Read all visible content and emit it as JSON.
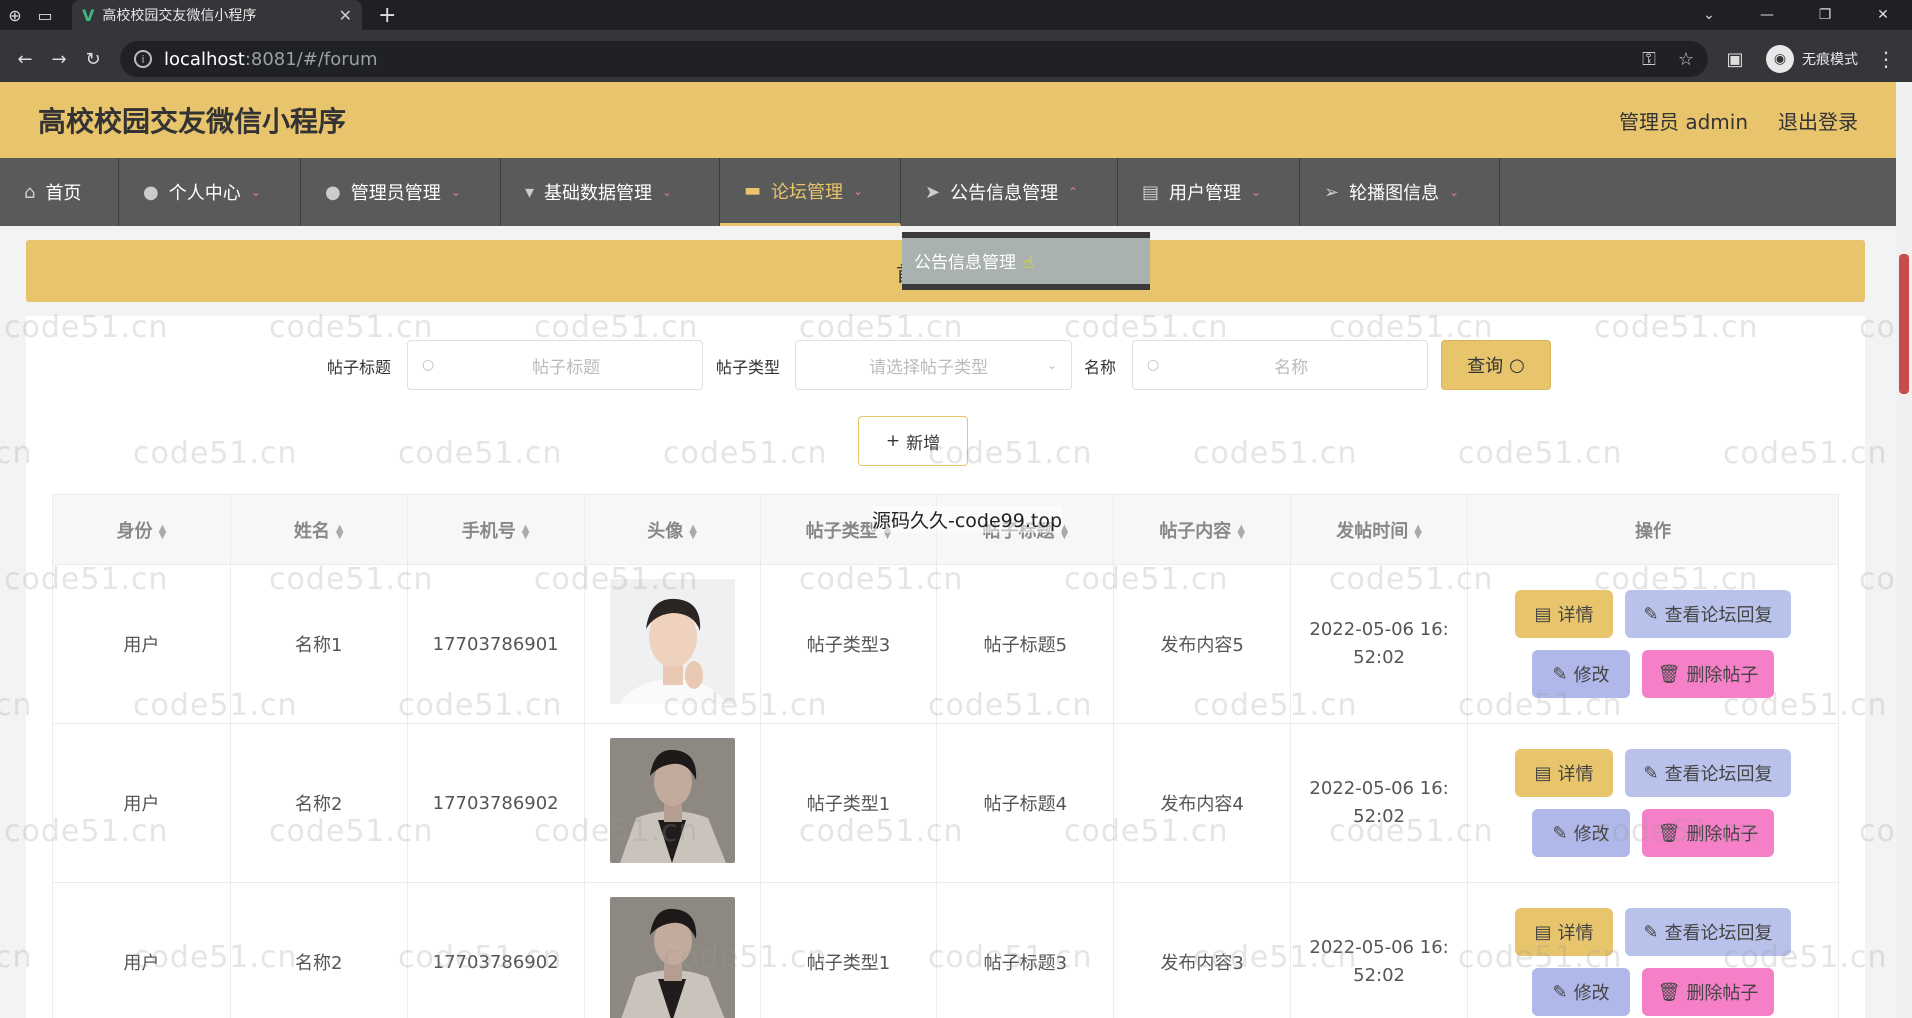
{
  "browser": {
    "tab_title": "高校校园交友微信小程序",
    "url_host": "localhost",
    "url_path": ":8081/#/forum",
    "incognito_label": "无痕模式"
  },
  "header": {
    "title": "高校校园交友微信小程序",
    "admin_label": "管理员 admin",
    "logout_label": "退出登录"
  },
  "nav": {
    "items": [
      {
        "label": "首页"
      },
      {
        "label": "个人中心"
      },
      {
        "label": "管理员管理"
      },
      {
        "label": "基础数据管理"
      },
      {
        "label": "论坛管理"
      },
      {
        "label": "公告信息管理"
      },
      {
        "label": "用户管理"
      },
      {
        "label": "轮播图信息"
      }
    ],
    "dropdown_item": "公告信息管理"
  },
  "banner_text": "首",
  "search": {
    "title_label": "帖子标题",
    "title_placeholder": "帖子标题",
    "type_label": "帖子类型",
    "type_placeholder": "请选择帖子类型",
    "name_label": "名称",
    "name_placeholder": "名称",
    "query_label": "查询",
    "add_label": "新增"
  },
  "table": {
    "headers": [
      "身份",
      "姓名",
      "手机号",
      "头像",
      "帖子类型",
      "帖子标题",
      "帖子内容",
      "发帖时间",
      "操作"
    ],
    "rows": [
      {
        "identity": "用户",
        "name": "名称1",
        "phone": "17703786901",
        "type": "帖子类型3",
        "title": "帖子标题5",
        "content": "发布内容5",
        "time": "2022-05-06 16:52:02"
      },
      {
        "identity": "用户",
        "name": "名称2",
        "phone": "17703786902",
        "type": "帖子类型1",
        "title": "帖子标题4",
        "content": "发布内容4",
        "time": "2022-05-06 16:52:02"
      },
      {
        "identity": "用户",
        "name": "名称2",
        "phone": "17703786902",
        "type": "帖子类型1",
        "title": "帖子标题3",
        "content": "发布内容3",
        "time": "2022-05-06 16:52:02"
      }
    ],
    "ops": {
      "detail": "详情",
      "reply": "查看论坛回复",
      "edit": "修改",
      "delete": "删除帖子"
    }
  },
  "watermark": "code51.cn",
  "overlay_text": "源码久久-code99.top",
  "colors": {
    "accent": "#e8c46d",
    "nav_bg": "#5a5a5a"
  }
}
